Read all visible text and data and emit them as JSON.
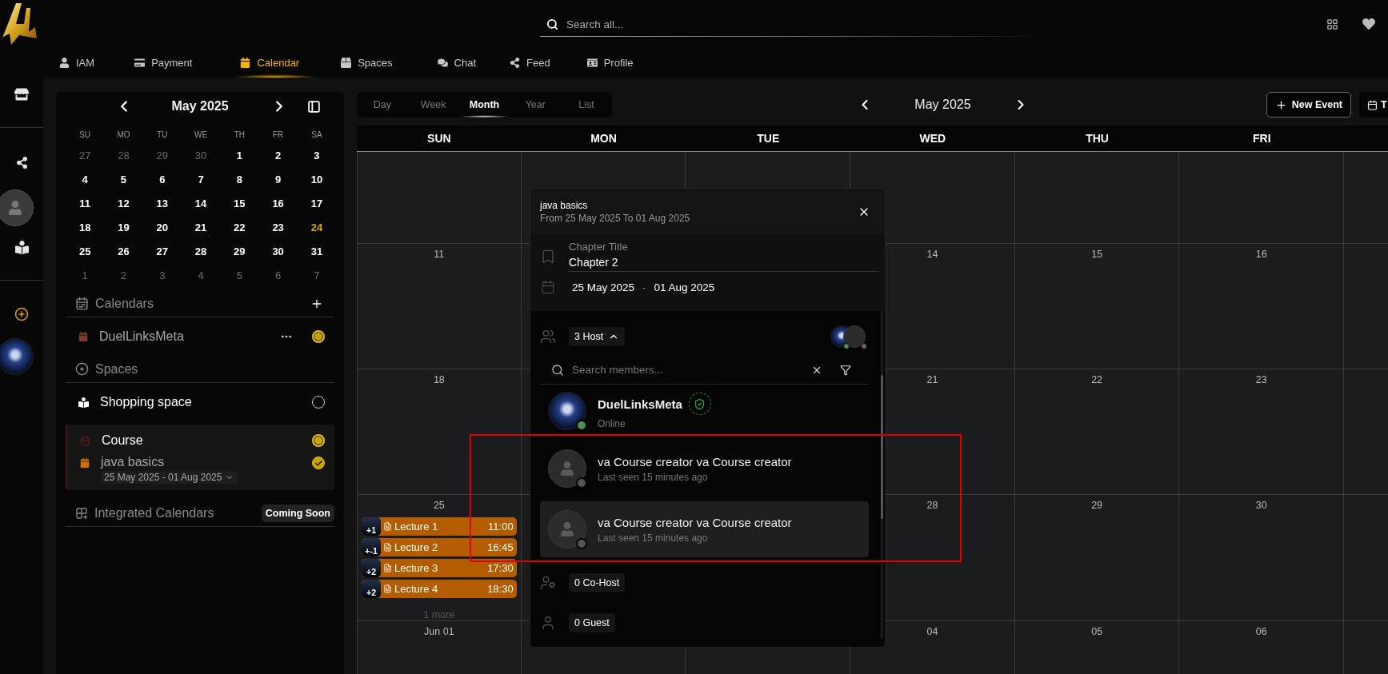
{
  "search": {
    "placeholder": "Search all..."
  },
  "nav_tabs": [
    {
      "label": "IAM",
      "selected": false
    },
    {
      "label": "Payment",
      "selected": false
    },
    {
      "label": "Calendar",
      "selected": true
    },
    {
      "label": "Spaces",
      "selected": false
    },
    {
      "label": "Chat",
      "selected": false
    },
    {
      "label": "Feed",
      "selected": false
    },
    {
      "label": "Profile",
      "selected": false
    }
  ],
  "mini_calendar": {
    "title": "May 2025",
    "weekdays": [
      "SU",
      "MO",
      "TU",
      "WE",
      "TH",
      "FR",
      "SA"
    ],
    "days": [
      {
        "label": "27",
        "kind": "outside"
      },
      {
        "label": "28",
        "kind": "outside"
      },
      {
        "label": "29",
        "kind": "outside"
      },
      {
        "label": "30",
        "kind": "outside"
      },
      {
        "label": "1",
        "kind": "day"
      },
      {
        "label": "2",
        "kind": "day"
      },
      {
        "label": "3",
        "kind": "day"
      },
      {
        "label": "4",
        "kind": "day"
      },
      {
        "label": "5",
        "kind": "day"
      },
      {
        "label": "6",
        "kind": "day"
      },
      {
        "label": "7",
        "kind": "day"
      },
      {
        "label": "8",
        "kind": "day"
      },
      {
        "label": "9",
        "kind": "day"
      },
      {
        "label": "10",
        "kind": "day"
      },
      {
        "label": "11",
        "kind": "day"
      },
      {
        "label": "12",
        "kind": "day"
      },
      {
        "label": "13",
        "kind": "day"
      },
      {
        "label": "14",
        "kind": "day"
      },
      {
        "label": "15",
        "kind": "day"
      },
      {
        "label": "16",
        "kind": "day"
      },
      {
        "label": "17",
        "kind": "day"
      },
      {
        "label": "18",
        "kind": "day"
      },
      {
        "label": "19",
        "kind": "day"
      },
      {
        "label": "20",
        "kind": "day"
      },
      {
        "label": "21",
        "kind": "day"
      },
      {
        "label": "22",
        "kind": "day"
      },
      {
        "label": "23",
        "kind": "day"
      },
      {
        "label": "24",
        "kind": "today"
      },
      {
        "label": "25",
        "kind": "day"
      },
      {
        "label": "26",
        "kind": "day"
      },
      {
        "label": "27",
        "kind": "day"
      },
      {
        "label": "28",
        "kind": "day"
      },
      {
        "label": "29",
        "kind": "day"
      },
      {
        "label": "30",
        "kind": "day"
      },
      {
        "label": "31",
        "kind": "day"
      },
      {
        "label": "1",
        "kind": "outside"
      },
      {
        "label": "2",
        "kind": "outside"
      },
      {
        "label": "3",
        "kind": "outside"
      },
      {
        "label": "4",
        "kind": "outside"
      },
      {
        "label": "5",
        "kind": "outside"
      },
      {
        "label": "6",
        "kind": "outside"
      },
      {
        "label": "7",
        "kind": "outside"
      }
    ]
  },
  "calendars": {
    "title": "Calendars",
    "items": [
      {
        "name": "DuelLinksMeta",
        "checked": true
      }
    ]
  },
  "spaces": {
    "title": "Spaces",
    "items": [
      {
        "name": "Shopping space",
        "checked": false,
        "expanded": false
      },
      {
        "name": "Course",
        "checked": true,
        "expanded": true,
        "children": [
          {
            "name": "java basics",
            "range": "25 May 2025 - 01 Aug 2025",
            "checked": true
          }
        ]
      }
    ]
  },
  "integrated": {
    "title": "Integrated Calendars",
    "badge": "Coming Soon"
  },
  "view_tabs": [
    {
      "label": "Day",
      "selected": false
    },
    {
      "label": "Week",
      "selected": false
    },
    {
      "label": "Month",
      "selected": true
    },
    {
      "label": "Year",
      "selected": false
    },
    {
      "label": "List",
      "selected": false
    }
  ],
  "month_title": "May 2025",
  "new_event": "New Event",
  "today_button": "T",
  "grid": {
    "weekdays": [
      "SUN",
      "MON",
      "TUE",
      "WED",
      "THU",
      "FRI"
    ],
    "rows": [
      {
        "cells": [
          null,
          null,
          null,
          null,
          null,
          null,
          null
        ]
      },
      {
        "cells": [
          {
            "date": "11"
          },
          null,
          null,
          {
            "date": "14"
          },
          {
            "date": "15"
          },
          {
            "date": "16"
          },
          null
        ]
      },
      {
        "cells": [
          {
            "date": "18"
          },
          null,
          null,
          {
            "date": "21"
          },
          {
            "date": "22"
          },
          {
            "date": "23"
          },
          null
        ]
      },
      {
        "cells": [
          {
            "date": "25",
            "events": [
              {
                "badge": "+1",
                "title": "Lecture 1",
                "time": "11:00"
              },
              {
                "badge": "+-1",
                "title": "Lecture 2",
                "time": "16:45"
              },
              {
                "badge": "+2",
                "title": "Lecture 3",
                "time": "17:30"
              },
              {
                "badge": "+2",
                "title": "Lecture 4",
                "time": "18:30"
              }
            ],
            "more": "1 more"
          },
          null,
          null,
          {
            "date": "28"
          },
          {
            "date": "29"
          },
          {
            "date": "30"
          },
          null
        ]
      },
      {
        "cells": [
          {
            "date": "Jun 01"
          },
          null,
          null,
          {
            "date": "04"
          },
          {
            "date": "05"
          },
          {
            "date": "06"
          },
          null
        ]
      }
    ]
  },
  "popup": {
    "title": "java basics",
    "subtitle": "From 25 May 2025 To 01 Aug 2025",
    "field_label": "Chapter Title",
    "field_value": "Chapter 2",
    "start": "25 May 2025",
    "separator": "-",
    "end": "01 Aug 2025",
    "search_placeholder": "Search members...",
    "groups": [
      {
        "count": "3",
        "label": "Host",
        "expanded": true,
        "members": [
          {
            "name": "DuelLinksMeta",
            "status": "Online",
            "kind": "logo",
            "online": true,
            "verified": true,
            "selected": false
          },
          {
            "name": "va Course creator va Course creator",
            "status": "Last seen 15 minutes ago",
            "kind": "person",
            "online": false,
            "verified": false,
            "selected": false
          },
          {
            "name": "va Course creator va Course creator",
            "status": "Last seen 15 minutes ago",
            "kind": "person",
            "online": false,
            "verified": false,
            "selected": true
          }
        ]
      },
      {
        "count": "0",
        "label": "Co-Host",
        "expanded": false
      },
      {
        "count": "0",
        "label": "Guest",
        "expanded": false
      }
    ]
  }
}
